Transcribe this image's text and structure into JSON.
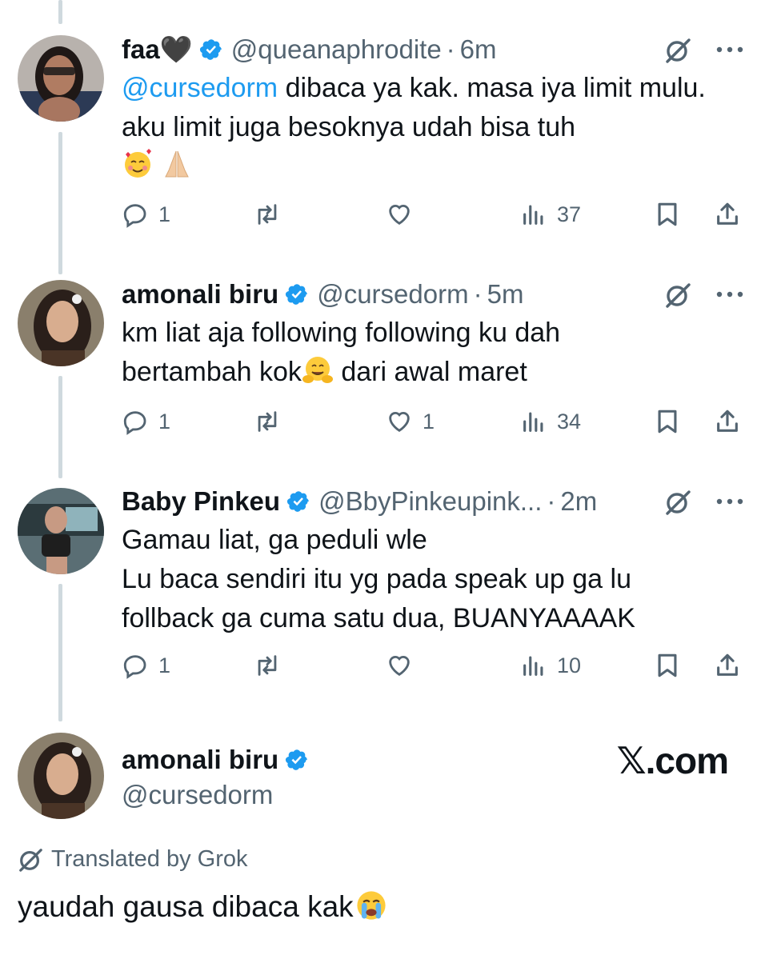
{
  "tweets": [
    {
      "name": "faa🖤",
      "handle": "@queanaphrodite",
      "time": "6m",
      "mention": "@cursedorm",
      "text": " dibaca ya kak. masa iya limit mulu. aku limit juga besoknya udah bisa tuh",
      "replies": "1",
      "reposts": "",
      "likes": "",
      "views": "37"
    },
    {
      "name": "amonali biru",
      "handle": "@cursedorm",
      "time": "5m",
      "text_a": "km liat aja following following ku dah bertambah kok",
      "text_b": " dari awal maret",
      "replies": "1",
      "reposts": "",
      "likes": "1",
      "views": "34"
    },
    {
      "name": "Baby Pinkeu",
      "handle": "@BbyPinkeupink...",
      "time": "2m",
      "line1": "Gamau liat, ga peduli wle",
      "line2": "Lu baca sendiri itu yg pada speak up ga lu follback ga cuma satu dua, BUANYAAAAK",
      "replies": "1",
      "reposts": "",
      "likes": "",
      "views": "10"
    }
  ],
  "main": {
    "name": "amonali biru",
    "handle": "@cursedorm",
    "brand": "𝕏.com",
    "translated_label": "Translated by Grok",
    "text": "yaudah gausa dibaca kak"
  },
  "colors": {
    "accent": "#1d9bf0",
    "muted": "#536471",
    "thread": "#cfd9de"
  },
  "icons": [
    "verified-badge-icon",
    "grok-icon",
    "more-icon",
    "reply-icon",
    "repost-icon",
    "like-icon",
    "views-icon",
    "bookmark-icon",
    "share-icon"
  ]
}
